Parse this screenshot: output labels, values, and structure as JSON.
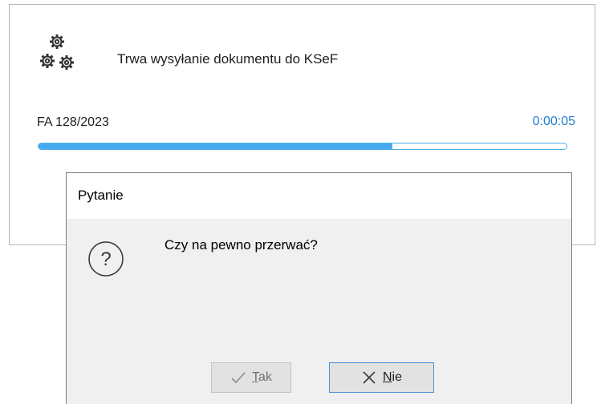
{
  "progress_window": {
    "title": "Trwa wysyłanie dokumentu do KSeF",
    "document": "FA 128/2023",
    "elapsed": "0:00:05",
    "progress_fraction": 0.67,
    "accent_color": "#45aaf0",
    "icon": "gears-icon"
  },
  "dialog": {
    "title": "Pytanie",
    "message": "Czy na pewno przerwać?",
    "icon": "question-icon",
    "buttons": {
      "yes_label": "Tak",
      "yes_icon": "checkmark-icon",
      "no_label": "Nie",
      "no_icon": "close-icon"
    }
  }
}
